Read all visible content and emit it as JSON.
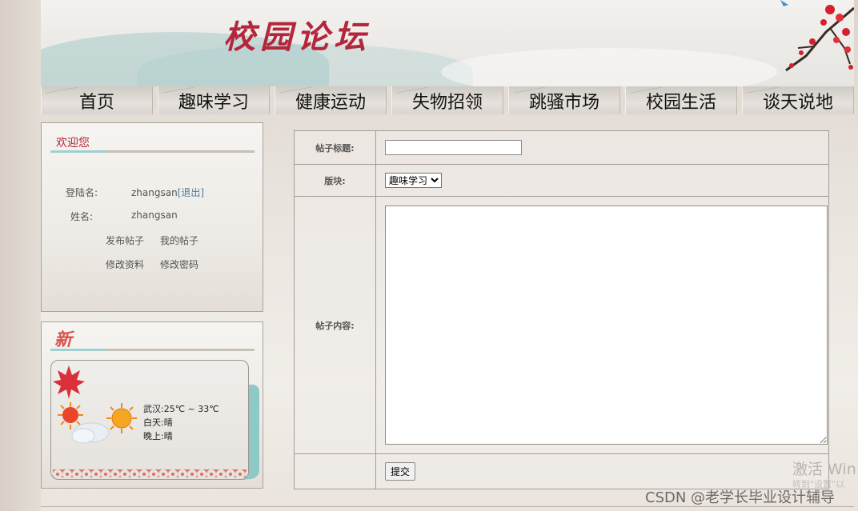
{
  "banner": {
    "title": "校园论坛"
  },
  "nav": {
    "items": [
      {
        "label": "首页"
      },
      {
        "label": "趣味学习"
      },
      {
        "label": "健康运动"
      },
      {
        "label": "失物招领"
      },
      {
        "label": "跳骚市场"
      },
      {
        "label": "校园生活"
      },
      {
        "label": "谈天说地"
      }
    ]
  },
  "welcome": {
    "title": "欢迎您",
    "login_label": "登陆名:",
    "login_value": "zhangsan",
    "logout_link": "[退出]",
    "name_label": "姓名:",
    "name_value": "zhangsan",
    "actions": [
      "发布帖子",
      "我的帖子",
      "修改资料",
      "修改密码"
    ]
  },
  "news": {
    "title": "新",
    "weather": {
      "city_temp": "武汉:25℃ ~ 33℃",
      "day": "白天:晴",
      "night": "晚上:晴"
    }
  },
  "form": {
    "title_label": "帖子标题:",
    "title_value": "",
    "section_label": "版块:",
    "section_selected": "趣味学习",
    "content_label": "帖子内容:",
    "content_value": "",
    "submit_label": "提交"
  },
  "overlay": {
    "activate_line1": "激活 Win",
    "activate_line2": "转到\"设置\"以",
    "watermark": "CSDN @老学长毕业设计辅导"
  },
  "colors": {
    "accent": "#b3263b",
    "link": "#4a7aa8",
    "teal": "#9ed0d0"
  }
}
